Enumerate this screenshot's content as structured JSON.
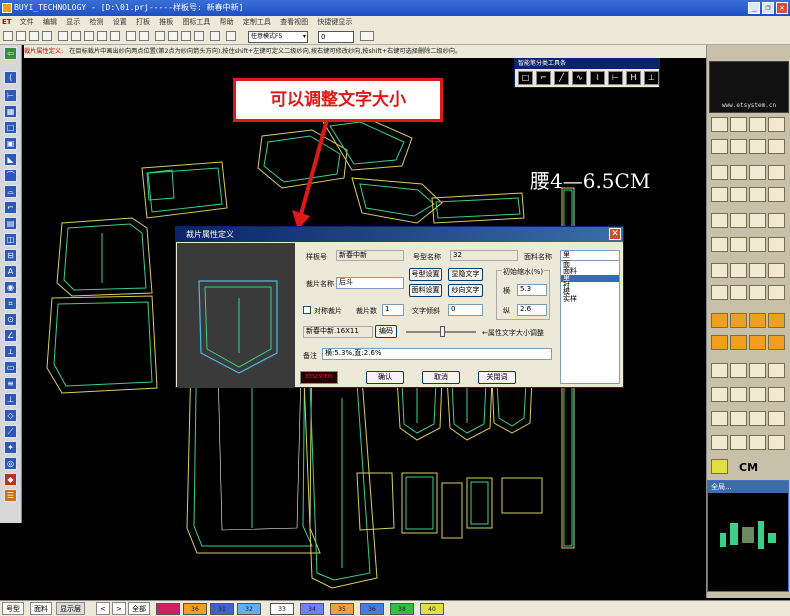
{
  "titlebar": {
    "title": "BUYI_TECHNOLOGY - [D:\\01.prj-----样板号: 新春中新]",
    "min": "_",
    "restore": "❐",
    "close": "✕"
  },
  "menubar": {
    "logo": "ET",
    "items": [
      "文件",
      "编辑",
      "显示",
      "检测",
      "设置",
      "打板",
      "推板",
      "图标工具",
      "帮助",
      "定制工具",
      "查看视图",
      "快捷键显示"
    ]
  },
  "toolbar": {
    "mode": "任意模式F5",
    "number": "0"
  },
  "hint": {
    "title": "裁片属性定义:",
    "text": "在目标裁片中画出纱向两点位置(第2点为纱向箭头方向),按住shift+左键可定义二级纱向,按右键可修改纱向,按shift+右键可选择删除二级纱向。"
  },
  "smarttoolbar": {
    "title": "智能笔分类工具条"
  },
  "callout": {
    "text": "可以调整文字大小"
  },
  "canvas_text": {
    "waist": "腰4—6.5CM"
  },
  "dialog": {
    "title": "裁片属性定义",
    "close": "✕",
    "style_no_label": "样板号",
    "style_no": "新春中新",
    "size_name_label": "号型名称",
    "size_name": "32",
    "fabric_name_label": "面料名称",
    "fabric_name": "里",
    "piece_name_label": "裁片名称",
    "piece_name": "后斗",
    "size_setting": "号型设置",
    "show_text": "显隐文字",
    "fabric_setting": "面料设置",
    "grain_text": "纱向文字",
    "symmetric_label": "对称裁片",
    "piece_count_label": "裁片数",
    "piece_count": "1",
    "text_angle_label": "文字倾斜",
    "text_angle": "0",
    "shrink_title": "初始缩水(%)",
    "horizontal_label": "横",
    "horizontal": "5.3",
    "vertical_label": "纵",
    "vertical": "2.6",
    "code_field": "新春中新.16X11",
    "encode_button": "编码",
    "slider_hint": "←属性文字大小调整",
    "note_label": "备注",
    "note": "横:5.3%,直:2.6%",
    "brand": "ETSYSTEM",
    "ok": "确认",
    "cancel": "取消",
    "close_btn": "关閉词",
    "fabric_list": [
      "面",
      "面料",
      "里",
      "衬",
      "模",
      "实样"
    ],
    "fabric_selected": "里"
  },
  "minimap": {
    "title": "全局..."
  },
  "right_panel": {
    "url": "www.etsystem.cn",
    "cm": "CM"
  },
  "bottombar": {
    "tabs": [
      "号型",
      "面料",
      "显示层"
    ],
    "nav": [
      "<",
      ">",
      "全部"
    ],
    "swatches": [
      {
        "label": "",
        "color": "#d02060"
      },
      {
        "label": "36",
        "color": "#f0a020"
      },
      {
        "label": "31",
        "color": "#4060d0"
      },
      {
        "label": "32",
        "color": "#60b0f0"
      },
      {
        "label": "33",
        "color": "#ffffff"
      },
      {
        "label": "34",
        "color": "#7080ff"
      },
      {
        "label": "35",
        "color": "#f0a040"
      },
      {
        "label": "36",
        "color": "#4080e0"
      },
      {
        "label": "38",
        "color": "#30c040"
      },
      {
        "label": "40",
        "color": "#e0e040"
      }
    ]
  },
  "colors": {
    "dialog_title": "#0a246a",
    "piece_yellow": "#d8d060",
    "piece_green": "#3ad08a",
    "callout_red": "#e01818"
  }
}
